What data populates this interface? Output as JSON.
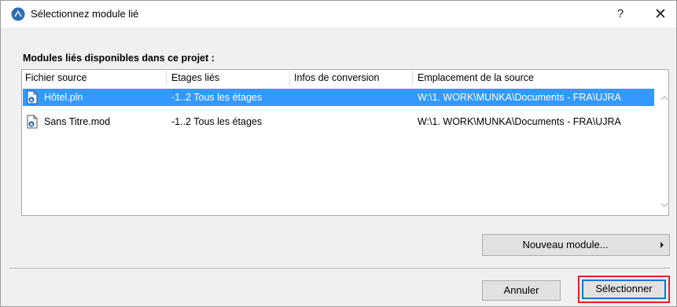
{
  "window": {
    "title": "Sélectionnez module lié",
    "help_label": "?",
    "close_label": "✕"
  },
  "section_label": "Modules liés disponibles dans ce projet :",
  "columns": [
    "Fichier source",
    "Etages liés",
    "Infos de conversion",
    "Emplacement de la source"
  ],
  "rows": [
    {
      "file": "Hôtel.pln",
      "stories": "-1..2 Tous les étages",
      "conversion": "",
      "location": "W:\\1. WORK\\MUNKA\\Documents - FRA\\UJRA",
      "icon": "pln-file-icon",
      "selected": true
    },
    {
      "file": "Sans Titre.mod",
      "stories": "-1..2 Tous les étages",
      "conversion": "",
      "location": "W:\\1. WORK\\MUNKA\\Documents - FRA\\UJRA",
      "icon": "mod-file-icon",
      "selected": false
    }
  ],
  "buttons": {
    "new_module": "Nouveau module...",
    "cancel": "Annuler",
    "select": "Sélectionner"
  },
  "colors": {
    "selection": "#3399ff",
    "highlight_outline": "#e81d2c",
    "default_button_border": "#0078d7"
  }
}
